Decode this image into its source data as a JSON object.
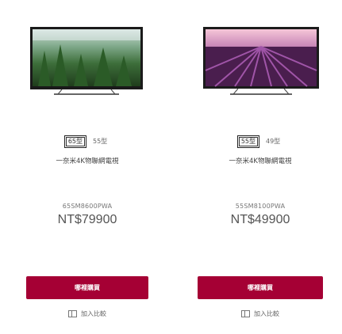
{
  "products": [
    {
      "image": "tv-forest-thumbnail",
      "sizes": [
        {
          "label": "65型",
          "selected": true
        },
        {
          "label": "55型",
          "selected": false
        }
      ],
      "title": "一奈米4K物聯網電視",
      "model": "65SM8600PWA",
      "price": "NT$79900",
      "buy_label": "哪裡購買",
      "compare_label": "加入比較"
    },
    {
      "image": "tv-lavender-thumbnail",
      "sizes": [
        {
          "label": "55型",
          "selected": true
        },
        {
          "label": "49型",
          "selected": false
        }
      ],
      "title": "一奈米4K物聯網電視",
      "model": "55SM8100PWA",
      "price": "NT$49900",
      "buy_label": "哪裡購買",
      "compare_label": "加入比較"
    }
  ],
  "colors": {
    "accent": "#a50034"
  }
}
